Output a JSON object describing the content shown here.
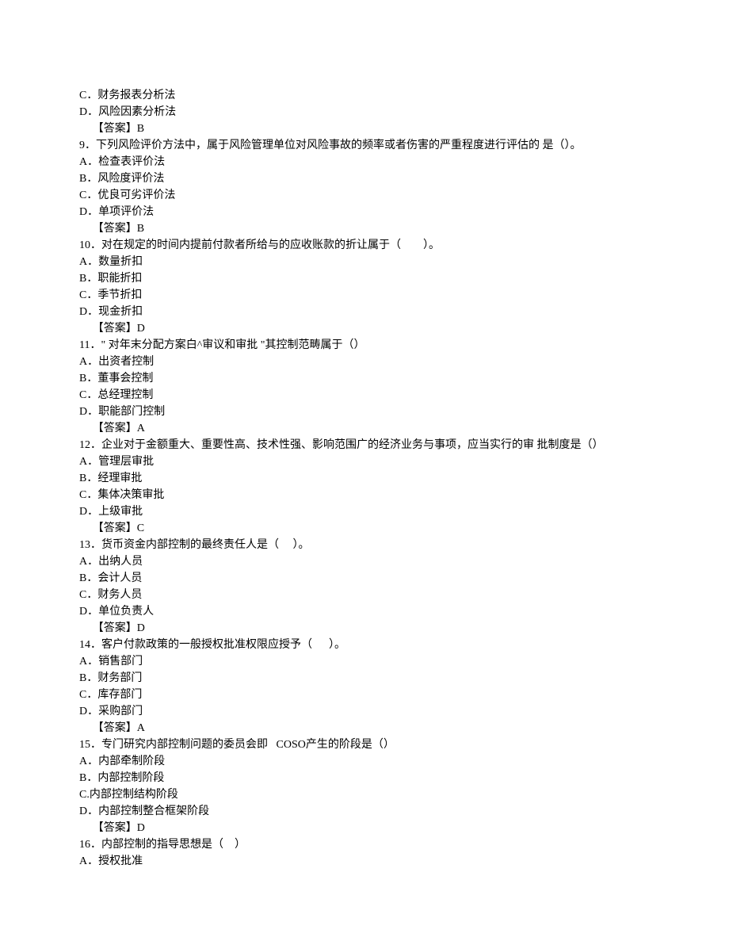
{
  "lines": [
    {
      "cls": "line",
      "text": "C．财务报表分析法"
    },
    {
      "cls": "line",
      "text": "D．风险因素分析法"
    },
    {
      "cls": "line answer",
      "text": "【答案】B"
    },
    {
      "cls": "line",
      "text": "9．下列风险评价方法中，属于风险管理单位对风险事故的频率或者伤害的严重程度进行评估的 是（）。"
    },
    {
      "cls": "line",
      "text": "A．检查表评价法"
    },
    {
      "cls": "line",
      "text": "B．风险度评价法"
    },
    {
      "cls": "line",
      "text": "C．优良可劣评价法"
    },
    {
      "cls": "line",
      "text": "D．单项评价法"
    },
    {
      "cls": "line answer",
      "text": "【答案】B"
    },
    {
      "cls": "line",
      "text": "10．对在规定的时间内提前付款者所给与的应收账款的折让属于（        ）。"
    },
    {
      "cls": "line",
      "text": "A．数量折扣"
    },
    {
      "cls": "line",
      "text": "B．职能折扣"
    },
    {
      "cls": "line",
      "text": "C．季节折扣"
    },
    {
      "cls": "line",
      "text": "D．现金折扣"
    },
    {
      "cls": "line answer",
      "text": "【答案】D"
    },
    {
      "cls": "line",
      "text": "11．\" 对年末分配方案白^审议和审批 \"其控制范畴属于（）"
    },
    {
      "cls": "line",
      "text": "A．出资者控制"
    },
    {
      "cls": "line",
      "text": "B．董事会控制"
    },
    {
      "cls": "line",
      "text": "C．总经理控制"
    },
    {
      "cls": "line",
      "text": "D．职能部门控制"
    },
    {
      "cls": "line answer",
      "text": "【答案】A"
    },
    {
      "cls": "line",
      "text": "12．企业对于金额重大、重要性高、技术性强、影响范围广的经济业务与事项，应当实行的审 批制度是（）"
    },
    {
      "cls": "line",
      "text": "A．管理层审批"
    },
    {
      "cls": "line",
      "text": "B．经理审批"
    },
    {
      "cls": "line",
      "text": "C．集体决策审批"
    },
    {
      "cls": "line",
      "text": "D．上级审批"
    },
    {
      "cls": "line answer",
      "text": "【答案】C"
    },
    {
      "cls": "line",
      "text": "13．货币资金内部控制的最终责任人是（     ）。"
    },
    {
      "cls": "line",
      "text": "A．出纳人员"
    },
    {
      "cls": "line",
      "text": "B．会计人员"
    },
    {
      "cls": "line",
      "text": "C．财务人员"
    },
    {
      "cls": "line",
      "text": "D．单位负责人"
    },
    {
      "cls": "line answer",
      "text": "【答案】D"
    },
    {
      "cls": "line",
      "text": "14．客户付款政策的一般授权批准权限应授予（      ）。"
    },
    {
      "cls": "line",
      "text": "A．销售部门"
    },
    {
      "cls": "line",
      "text": "B．财务部门"
    },
    {
      "cls": "line",
      "text": "C．库存部门"
    },
    {
      "cls": "line",
      "text": "D．采购部门"
    },
    {
      "cls": "line answer",
      "text": "【答案】A"
    },
    {
      "cls": "line",
      "text": "15．专门研究内部控制问题的委员会即   COSO产生的阶段是（）"
    },
    {
      "cls": "line",
      "text": "A．内部牵制阶段"
    },
    {
      "cls": "line",
      "text": "B．内部控制阶段"
    },
    {
      "cls": "line",
      "text": "C.内部控制结构阶段"
    },
    {
      "cls": "line",
      "text": "D．内部控制整合框架阶段"
    },
    {
      "cls": "line answer",
      "text": "【答案】D"
    },
    {
      "cls": "line",
      "text": "16．内部控制的指导思想是（    ）"
    },
    {
      "cls": "line",
      "text": "A．授权批准"
    }
  ]
}
